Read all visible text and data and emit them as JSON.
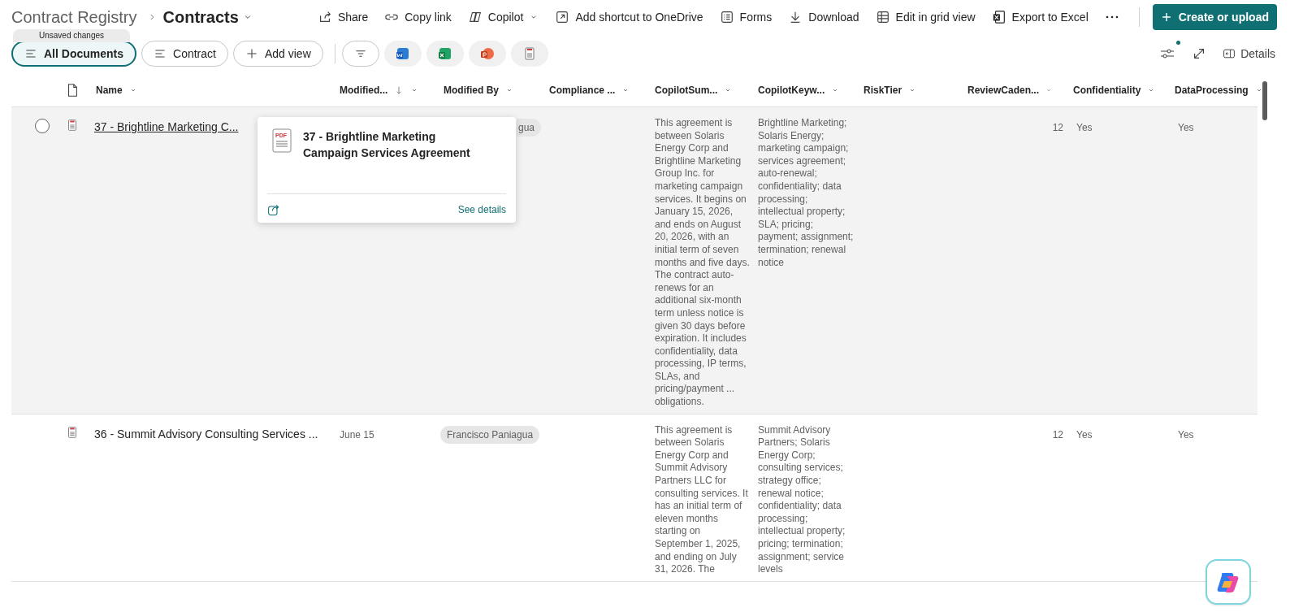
{
  "breadcrumb": {
    "parent": "Contract Registry",
    "current": "Contracts"
  },
  "commands": [
    {
      "label": "Share",
      "kind": "share"
    },
    {
      "label": "Copy link",
      "kind": "link"
    },
    {
      "label": "Copilot",
      "kind": "copilot",
      "dropdown": true
    },
    {
      "label": "Add shortcut to OneDrive",
      "kind": "shortcut"
    },
    {
      "label": "Forms",
      "kind": "forms"
    },
    {
      "label": "Download",
      "kind": "download"
    },
    {
      "label": "Edit in grid view",
      "kind": "grid"
    },
    {
      "label": "Export to Excel",
      "kind": "excel"
    }
  ],
  "primary_button": "Create or upload",
  "unsaved_badge": "Unsaved changes",
  "views": [
    {
      "label": "All Documents",
      "kind": "view",
      "selected": true
    },
    {
      "label": "Contract",
      "kind": "view",
      "selected": false
    },
    {
      "label": "Add view",
      "kind": "add",
      "selected": false
    }
  ],
  "file_filters": [
    {
      "kind": "word"
    },
    {
      "kind": "excel"
    },
    {
      "kind": "powerpoint"
    },
    {
      "kind": "pdf"
    }
  ],
  "details_button": "Details",
  "columns": [
    {
      "label": "Name",
      "sorted": false
    },
    {
      "label": "Modified...",
      "sorted": true
    },
    {
      "label": "Modified By",
      "sorted": false
    },
    {
      "label": "Compliance ...",
      "sorted": false
    },
    {
      "label": "CopilotSum...",
      "sorted": false
    },
    {
      "label": "CopilotKeyw...",
      "sorted": false
    },
    {
      "label": "RiskTier",
      "sorted": false
    },
    {
      "label": "ReviewCaden...",
      "sorted": false
    },
    {
      "label": "Confidentiality",
      "sorted": false
    },
    {
      "label": "DataProcessing",
      "sorted": false
    }
  ],
  "rows": [
    {
      "hovered": true,
      "name": "37 - Brightline Marketing C...",
      "modified_by": "gua",
      "summary": "This agreement is between Solaris Energy Corp and Brightline Marketing Group Inc. for marketing campaign services. It begins on January 15, 2026, and ends on August 20, 2026, with an initial term of seven months and five days. The contract auto-renews for an additional six-month term unless notice is given 30 days before expiration. It includes confidentiality, data processing, IP terms, SLAs, and pricing/payment ... obligations.",
      "keywords": "Brightline Marketing; Solaris Energy; marketing campaign; services agreement; auto-renewal; confidentiality; data processing; intellectual property; SLA; pricing; payment; assignment; termination; renewal notice",
      "review_cadence": "12",
      "confidentiality": "Yes",
      "data_processing": "Yes"
    },
    {
      "hovered": false,
      "name": "36 - Summit Advisory Consulting Services ...",
      "modified": "June 15",
      "modified_by": "Francisco Paniagua",
      "summary": "This agreement is between Solaris Energy Corp and Summit Advisory Partners LLC for consulting services. It has an initial term of eleven months starting on September 1, 2025, and ending on July 31, 2026. The",
      "keywords": "Summit Advisory Partners; Solaris Energy Corp; consulting services; strategy office; renewal notice; confidentiality; data processing; intellectual property; pricing; termination; assignment; service levels",
      "review_cadence": "12",
      "confidentiality": "Yes",
      "data_processing": "Yes"
    }
  ],
  "hover_card": {
    "icon_label": "PDF",
    "title": "37 - Brightline Marketing Campaign Services Agreement",
    "link": "See details"
  }
}
